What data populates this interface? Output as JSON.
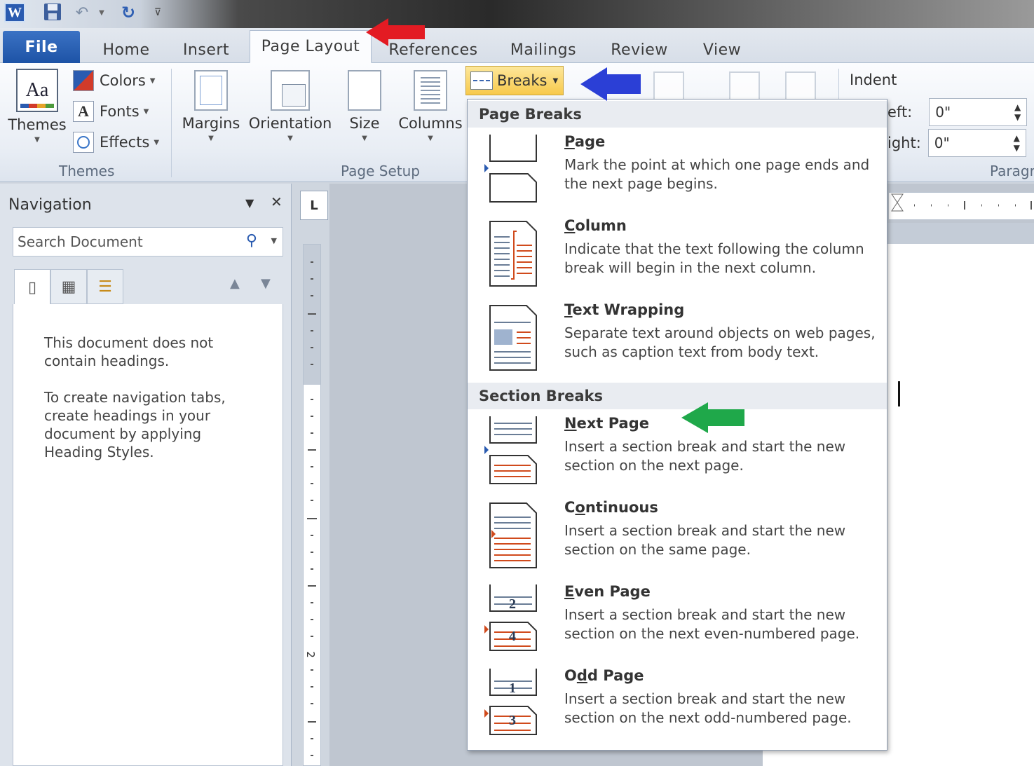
{
  "titlebar": {
    "app_icon": "word-app-icon",
    "app_letter": "W",
    "quick_access": [
      "save-icon",
      "undo-icon",
      "redo-icon",
      "customize-qa-icon"
    ]
  },
  "tabs": [
    {
      "label": "File"
    },
    {
      "label": "Home"
    },
    {
      "label": "Insert"
    },
    {
      "label": "Page Layout",
      "active": true
    },
    {
      "label": "References"
    },
    {
      "label": "Mailings"
    },
    {
      "label": "Review"
    },
    {
      "label": "View"
    }
  ],
  "ribbon": {
    "themes_group": {
      "label": "Themes",
      "themes_button": "Themes",
      "themes_icon_text": "Aa",
      "colors": "Colors",
      "fonts": "Fonts",
      "fonts_icon_text": "A",
      "effects": "Effects"
    },
    "page_setup_group": {
      "label": "Page Setup",
      "margins": "Margins",
      "orientation": "Orientation",
      "size": "Size",
      "columns": "Columns",
      "breaks": "Breaks"
    },
    "paragraph_group": {
      "label": "Paragr",
      "indent_title": "Indent",
      "left_label": "eft:",
      "left_value": "0\"",
      "right_label": "ight:",
      "right_value": "0\""
    }
  },
  "navigation": {
    "title": "Navigation",
    "search_placeholder": "Search Document",
    "message_1": "This document does not contain headings.",
    "message_2": "To create navigation tabs, create headings in your document by applying Heading Styles."
  },
  "ruler": {
    "corner": "L",
    "vertical_number": "2"
  },
  "breaks_menu": {
    "page_breaks_header": "Page Breaks",
    "section_breaks_header": "Section Breaks",
    "items": [
      {
        "title_pre": "",
        "title_acc": "P",
        "title_post": "age",
        "desc": "Mark the point at which one page ends and the next page begins.",
        "icon": "page-break-icon"
      },
      {
        "title_pre": "",
        "title_acc": "C",
        "title_post": "olumn",
        "desc": "Indicate that the text following the column break will begin in the next column.",
        "icon": "column-break-icon"
      },
      {
        "title_pre": "",
        "title_acc": "T",
        "title_post": "ext Wrapping",
        "desc": "Separate text around objects on web pages, such as caption text from body text.",
        "icon": "text-wrapping-icon"
      },
      {
        "title_pre": "",
        "title_acc": "N",
        "title_post": "ext Page",
        "desc": "Insert a section break and start the new section on the next page.",
        "icon": "next-page-icon"
      },
      {
        "title_pre": "C",
        "title_acc": "o",
        "title_post": "ntinuous",
        "desc": "Insert a section break and start the new section on the same page.",
        "icon": "continuous-icon"
      },
      {
        "title_pre": "",
        "title_acc": "E",
        "title_post": "ven Page",
        "desc": "Insert a section break and start the new section on the next even-numbered page.",
        "icon": "even-page-icon",
        "nums": [
          "2",
          "4"
        ]
      },
      {
        "title_pre": "O",
        "title_acc": "d",
        "title_post": "d Page",
        "desc": "Insert a section break and start the new section on the next odd-numbered page.",
        "icon": "odd-page-icon",
        "nums": [
          "1",
          "3"
        ]
      }
    ]
  },
  "annotations": {
    "red": "#e31b23",
    "blue": "#2b3fd6",
    "green": "#1fa84a"
  },
  "colors": {
    "file_tab": "#2a62b8",
    "breaks_highlight": "#f7c94c",
    "icon_accent": "#d04a1c"
  }
}
